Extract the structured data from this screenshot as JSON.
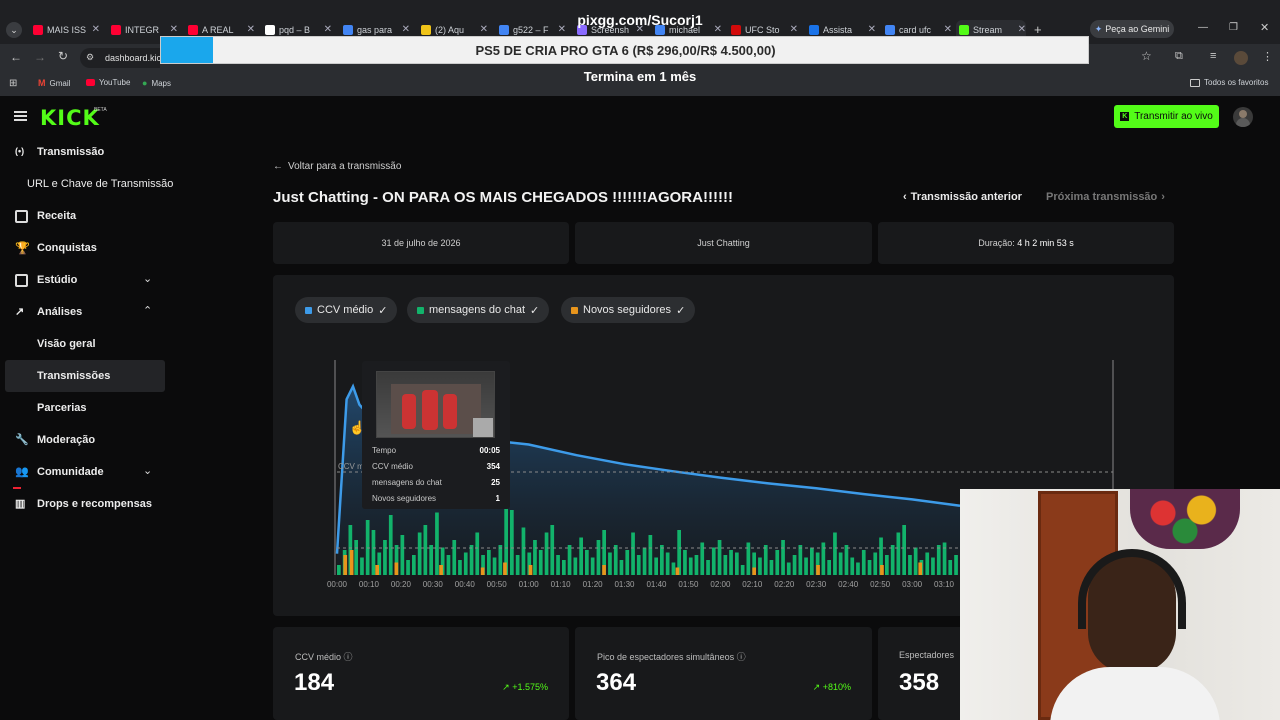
{
  "browser": {
    "tabs": [
      {
        "label": "MAIS ISS",
        "color": "#ff0033"
      },
      {
        "label": "INTEGR",
        "color": "#ff0033"
      },
      {
        "label": "A REAL",
        "color": "#ff0033"
      },
      {
        "label": "pqd – B",
        "color": "#ffffff"
      },
      {
        "label": "gas para",
        "color": "#4285f4"
      },
      {
        "label": "(2) Aqu",
        "color": "#f0c419"
      },
      {
        "label": "g522 – F",
        "color": "#4285f4"
      },
      {
        "label": "Screensh",
        "color": "#8a6bff"
      },
      {
        "label": "michael",
        "color": "#4285f4"
      },
      {
        "label": "UFC Sto",
        "color": "#d20a0a"
      },
      {
        "label": "Assista",
        "color": "#1a73e8"
      },
      {
        "label": "card ufc",
        "color": "#4285f4"
      },
      {
        "label": "Stream",
        "color": "#53fc18"
      }
    ],
    "gemini_label": "Peça ao Gemini",
    "url": "dashboard.kick",
    "bookmarks": [
      "Gmail",
      "YouTube",
      "Maps"
    ],
    "all_favorites": "Todos os favoritos"
  },
  "overlay": {
    "top": "pixgg.com/Sucorj1",
    "bar_text": "PS5 DE CRIA PRO GTA 6 (R$ 296,00/R$ 4.500,00)",
    "bar_progress": 0.0658,
    "sub": "Termina em 1 mês"
  },
  "header": {
    "logo": "KICK",
    "logo_badge": "BETA",
    "live_button": "Transmitir ao vivo"
  },
  "sidebar": {
    "items": [
      {
        "label": "Transmissão"
      },
      {
        "label": "URL e Chave de Transmissão"
      },
      {
        "label": "Receita"
      },
      {
        "label": "Conquistas"
      },
      {
        "label": "Estúdio"
      },
      {
        "label": "Análises"
      },
      {
        "label": "Visão geral"
      },
      {
        "label": "Transmissões"
      },
      {
        "label": "Parcerias"
      },
      {
        "label": "Moderação"
      },
      {
        "label": "Comunidade"
      },
      {
        "label": "Drops e recompensas"
      }
    ]
  },
  "main": {
    "back_link": "Voltar para a transmissão",
    "title": "Just Chatting - ON PARA OS MAIS CHEGADOS !!!!!!!AGORA!!!!!!",
    "prev": "Transmissão anterior",
    "next": "Próxima transmissão",
    "info": {
      "date": "31 de julho de 2026",
      "category": "Just Chatting",
      "duration_label": "Duração:",
      "duration_value": "4 h 2 min 53 s"
    },
    "filters": [
      {
        "label": "CCV médio",
        "color": "#3d9be9"
      },
      {
        "label": "mensagens do chat",
        "color": "#12b36b"
      },
      {
        "label": "Novos seguidores",
        "color": "#e8951c"
      }
    ],
    "avg_marker": "CCV m",
    "tooltip": {
      "rows": [
        {
          "label": "Tempo",
          "value": "00:05"
        },
        {
          "label": "CCV médio",
          "value": "354"
        },
        {
          "label": "mensagens do chat",
          "value": "25"
        },
        {
          "label": "Novos seguidores",
          "value": "1"
        }
      ]
    },
    "stats": [
      {
        "label": "CCV médio",
        "value": "184",
        "delta": "+1.575%"
      },
      {
        "label": "Pico de espectadores simultâneos",
        "value": "364",
        "delta": "+810%"
      },
      {
        "label": "Espectadores",
        "value": "358",
        "delta": ""
      }
    ]
  },
  "chart_data": {
    "type": "area",
    "x_ticks": [
      "00:00",
      "00:10",
      "00:20",
      "00:30",
      "00:40",
      "00:50",
      "01:00",
      "01:10",
      "01:20",
      "01:30",
      "01:40",
      "01:50",
      "02:00",
      "02:10",
      "02:20",
      "02:30",
      "02:40",
      "02:50",
      "03:00",
      "03:10"
    ],
    "series": [
      {
        "name": "CCV médio",
        "color": "#3d9be9",
        "x_minutes": [
          0,
          3,
          5,
          7,
          10,
          30,
          60,
          75,
          90,
          105,
          120,
          135,
          150,
          165,
          180,
          195
        ],
        "values": [
          40,
          330,
          354,
          320,
          300,
          265,
          245,
          225,
          208,
          195,
          183,
          172,
          163,
          152,
          142,
          130
        ]
      },
      {
        "name": "mensagens do chat",
        "color": "#12b36b",
        "values": [
          4,
          10,
          20,
          14,
          7,
          22,
          18,
          9,
          14,
          24,
          12,
          16,
          6,
          8,
          17,
          20,
          12,
          25,
          11,
          8,
          14,
          6,
          9,
          12,
          17,
          8,
          10,
          7,
          12,
          30,
          26,
          8,
          19,
          9,
          14,
          10,
          17,
          20,
          8,
          6,
          12,
          7,
          15,
          10,
          7,
          14,
          18,
          9,
          12,
          6,
          10,
          17,
          8,
          11,
          16,
          7,
          12,
          9,
          5,
          18,
          10,
          7,
          8,
          13,
          6,
          11,
          14,
          8,
          10,
          9,
          4,
          13,
          9,
          7,
          12,
          6,
          10,
          14,
          5,
          8,
          12,
          7,
          11,
          9,
          13,
          6,
          17,
          9,
          12,
          7,
          5,
          10,
          6,
          9,
          15,
          8,
          12,
          17,
          20,
          8,
          11,
          6,
          9,
          7,
          12,
          13,
          6,
          8
        ]
      },
      {
        "name": "Novos seguidores",
        "color": "#e8951c",
        "points": [
          [
            2,
            8
          ],
          [
            4,
            10
          ],
          [
            12,
            4
          ],
          [
            18,
            5
          ],
          [
            32,
            4
          ],
          [
            45,
            3
          ],
          [
            52,
            5
          ],
          [
            60,
            4
          ],
          [
            83,
            4
          ],
          [
            106,
            3
          ],
          [
            130,
            3
          ],
          [
            150,
            4
          ],
          [
            170,
            4
          ],
          [
            182,
            5
          ],
          [
            195,
            12
          ]
        ]
      }
    ]
  }
}
